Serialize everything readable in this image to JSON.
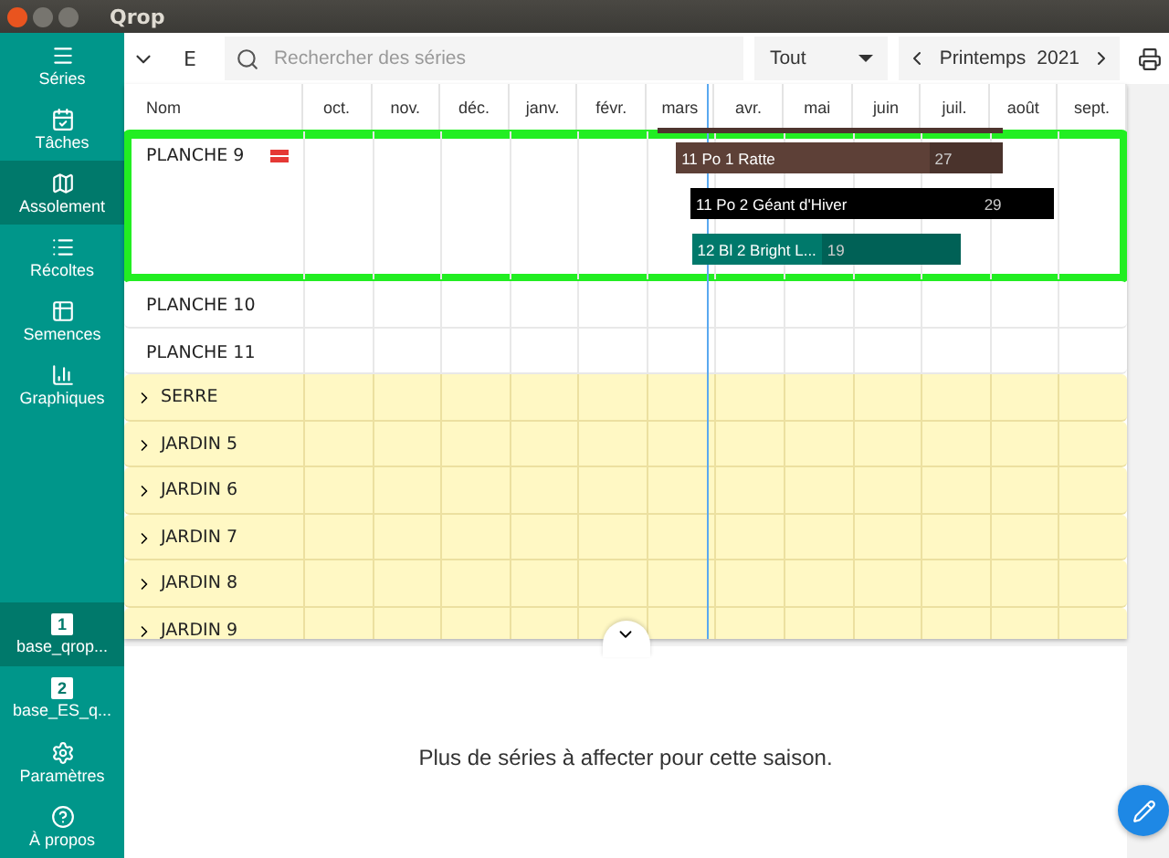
{
  "window": {
    "title": "Qrop"
  },
  "sidebar": {
    "items": [
      {
        "label": "Séries",
        "selected": false
      },
      {
        "label": "Tâches",
        "selected": false
      },
      {
        "label": "Assolement",
        "selected": true
      },
      {
        "label": "Récoltes",
        "selected": false
      },
      {
        "label": "Semences",
        "selected": false
      },
      {
        "label": "Graphiques",
        "selected": false
      }
    ],
    "databases": [
      {
        "number": "1",
        "label": "base_qrop...",
        "selected": true
      },
      {
        "number": "2",
        "label": "base_ES_q...",
        "selected": false
      }
    ],
    "footer": [
      {
        "label": "Paramètres"
      },
      {
        "label": "À propos"
      }
    ]
  },
  "toolbar": {
    "letter": "E",
    "search": {
      "placeholder": "Rechercher des séries"
    },
    "filter": "Tout",
    "season": "Printemps",
    "year": "2021"
  },
  "table": {
    "columns": [
      "Nom",
      "oct.",
      "nov.",
      "déc.",
      "janv.",
      "févr.",
      "mars",
      "avr.",
      "mai",
      "juin",
      "juil.",
      "août",
      "sept."
    ],
    "rows": [
      {
        "name": "PLANCHE 9",
        "kind": "plot",
        "highlighted": true,
        "conflict": true,
        "bars": [
          {
            "label": "11 Po 1 Ratte",
            "harvest": "27",
            "color": "#5d4037"
          },
          {
            "label": "11 Po 2 Géant d'Hiver",
            "harvest": "29",
            "color": "#000000"
          },
          {
            "label": "12 Bl 2 Bright L...",
            "harvest": "19",
            "color": "#00796b"
          }
        ]
      },
      {
        "name": "PLANCHE 10",
        "kind": "plot",
        "highlighted": false,
        "conflict": false
      },
      {
        "name": "PLANCHE 11",
        "kind": "plot",
        "highlighted": false,
        "conflict": false
      },
      {
        "name": "SERRE",
        "kind": "group",
        "expanded": false
      },
      {
        "name": "JARDIN 5",
        "kind": "group",
        "expanded": false
      },
      {
        "name": "JARDIN 6",
        "kind": "group",
        "expanded": false
      },
      {
        "name": "JARDIN 7",
        "kind": "group",
        "expanded": false
      },
      {
        "name": "JARDIN 8",
        "kind": "group",
        "expanded": false
      },
      {
        "name": "JARDIN 9",
        "kind": "group",
        "expanded": false
      }
    ]
  },
  "bottom_panel": {
    "message": "Plus de séries à affecter pour cette saison."
  }
}
